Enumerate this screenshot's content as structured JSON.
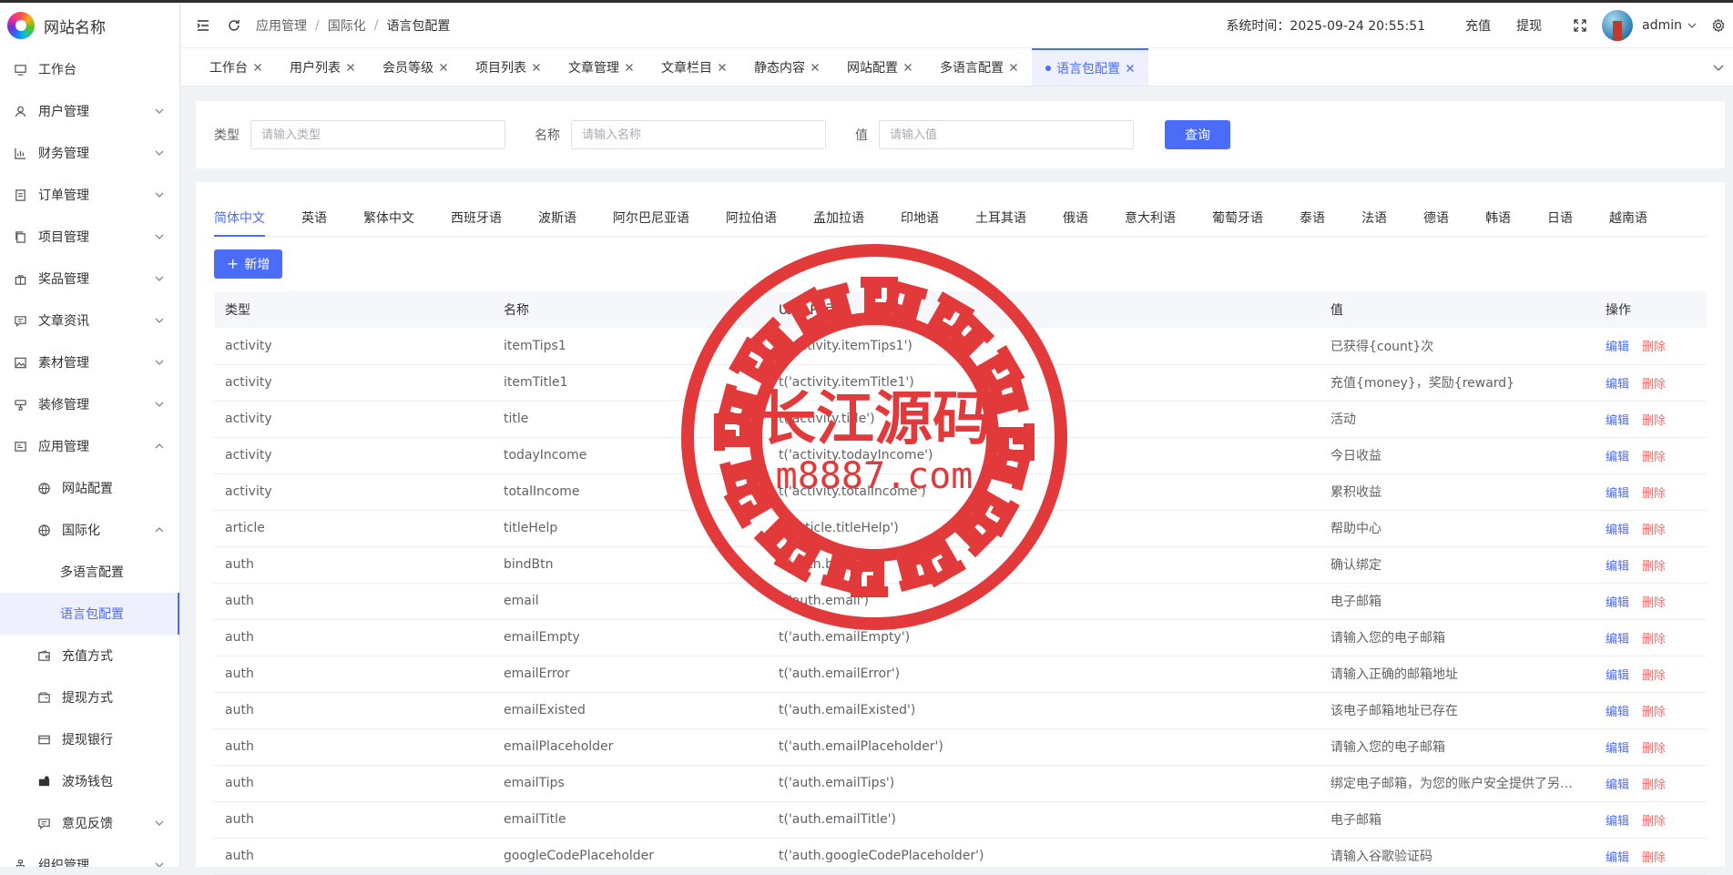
{
  "site": {
    "name": "网站名称"
  },
  "sidebar": {
    "items": [
      {
        "label": "工作台",
        "icon": "monitor-icon",
        "expandable": false
      },
      {
        "label": "用户管理",
        "icon": "user-icon",
        "expandable": true
      },
      {
        "label": "财务管理",
        "icon": "chart-icon",
        "expandable": true
      },
      {
        "label": "订单管理",
        "icon": "document-icon",
        "expandable": true
      },
      {
        "label": "项目管理",
        "icon": "copy-icon",
        "expandable": true
      },
      {
        "label": "奖品管理",
        "icon": "gift-icon",
        "expandable": true
      },
      {
        "label": "文章资讯",
        "icon": "message-icon",
        "expandable": true
      },
      {
        "label": "素材管理",
        "icon": "picture-icon",
        "expandable": true
      },
      {
        "label": "装修管理",
        "icon": "brush-icon",
        "expandable": true
      },
      {
        "label": "应用管理",
        "icon": "app-icon",
        "expandable": true,
        "expanded": true
      },
      {
        "label": "网站配置",
        "icon": "globe-icon",
        "level": 1
      },
      {
        "label": "国际化",
        "icon": "globe-icon",
        "level": 1,
        "expandable": true,
        "expanded": true
      },
      {
        "label": "多语言配置",
        "level": 2
      },
      {
        "label": "语言包配置",
        "level": 2,
        "active": true
      },
      {
        "label": "充值方式",
        "icon": "wallet-icon",
        "level": 1
      },
      {
        "label": "提现方式",
        "icon": "wallet-out-icon",
        "level": 1
      },
      {
        "label": "提现银行",
        "icon": "card-icon",
        "level": 1
      },
      {
        "label": "波场钱包",
        "icon": "coin-wallet-icon",
        "level": 1
      },
      {
        "label": "意见反馈",
        "icon": "message-icon",
        "level": 1,
        "expandable": true
      },
      {
        "label": "组织管理",
        "icon": "org-icon",
        "expandable": true
      }
    ]
  },
  "header": {
    "breadcrumb": [
      "应用管理",
      "国际化",
      "语言包配置"
    ],
    "system_time_label": "系统时间：",
    "system_time": "2025-09-24 20:55:51",
    "recharge": "充值",
    "withdraw": "提现",
    "user": "admin"
  },
  "tabs": [
    {
      "label": "工作台"
    },
    {
      "label": "用户列表"
    },
    {
      "label": "会员等级"
    },
    {
      "label": "项目列表"
    },
    {
      "label": "文章管理"
    },
    {
      "label": "文章栏目"
    },
    {
      "label": "静态内容"
    },
    {
      "label": "网站配置"
    },
    {
      "label": "多语言配置"
    },
    {
      "label": "语言包配置",
      "active": true
    }
  ],
  "search": {
    "type_label": "类型",
    "type_placeholder": "请输入类型",
    "name_label": "名称",
    "name_placeholder": "请输入名称",
    "value_label": "值",
    "value_placeholder": "请输入值",
    "query_button": "查询"
  },
  "languages": [
    "简体中文",
    "英语",
    "繁体中文",
    "西班牙语",
    "波斯语",
    "阿尔巴尼亚语",
    "阿拉伯语",
    "孟加拉语",
    "印地语",
    "土耳其语",
    "俄语",
    "意大利语",
    "葡萄牙语",
    "泰语",
    "法语",
    "德语",
    "韩语",
    "日语",
    "越南语"
  ],
  "active_language": "简体中文",
  "add_button": "新增",
  "table": {
    "columns": [
      "类型",
      "名称",
      "UNIAPP引用",
      "值",
      "操作"
    ],
    "edit_label": "编辑",
    "delete_label": "删除",
    "rows": [
      [
        "activity",
        "itemTips1",
        "t('activity.itemTips1')",
        "已获得{count}次"
      ],
      [
        "activity",
        "itemTitle1",
        "t('activity.itemTitle1')",
        "充值{money}，奖励{reward}"
      ],
      [
        "activity",
        "title",
        "t('activity.title')",
        "活动"
      ],
      [
        "activity",
        "todayIncome",
        "t('activity.todayIncome')",
        "今日收益"
      ],
      [
        "activity",
        "totalIncome",
        "t('activity.totalIncome')",
        "累积收益"
      ],
      [
        "article",
        "titleHelp",
        "t('article.titleHelp')",
        "帮助中心"
      ],
      [
        "auth",
        "bindBtn",
        "t('auth.bindBtn')",
        "确认绑定"
      ],
      [
        "auth",
        "email",
        "t('auth.email')",
        "电子邮箱"
      ],
      [
        "auth",
        "emailEmpty",
        "t('auth.emailEmpty')",
        "请输入您的电子邮箱"
      ],
      [
        "auth",
        "emailError",
        "t('auth.emailError')",
        "请输入正确的邮箱地址"
      ],
      [
        "auth",
        "emailExisted",
        "t('auth.emailExisted')",
        "该电子邮箱地址已存在"
      ],
      [
        "auth",
        "emailPlaceholder",
        "t('auth.emailPlaceholder')",
        "请输入您的电子邮箱"
      ],
      [
        "auth",
        "emailTips",
        "t('auth.emailTips')",
        "绑定电子邮箱，为您的账户安全提供了另一层保护"
      ],
      [
        "auth",
        "emailTitle",
        "t('auth.emailTitle')",
        "电子邮箱"
      ],
      [
        "auth",
        "googleCodePlaceholder",
        "t('auth.googleCodePlaceholder')",
        "请输入谷歌验证码"
      ]
    ]
  },
  "watermark": {
    "title": "长江源码",
    "domain": "m8887.com",
    "color": "#e23a3a"
  },
  "colors": {
    "primary": "#4a6cf7",
    "danger": "#f56c6c"
  }
}
